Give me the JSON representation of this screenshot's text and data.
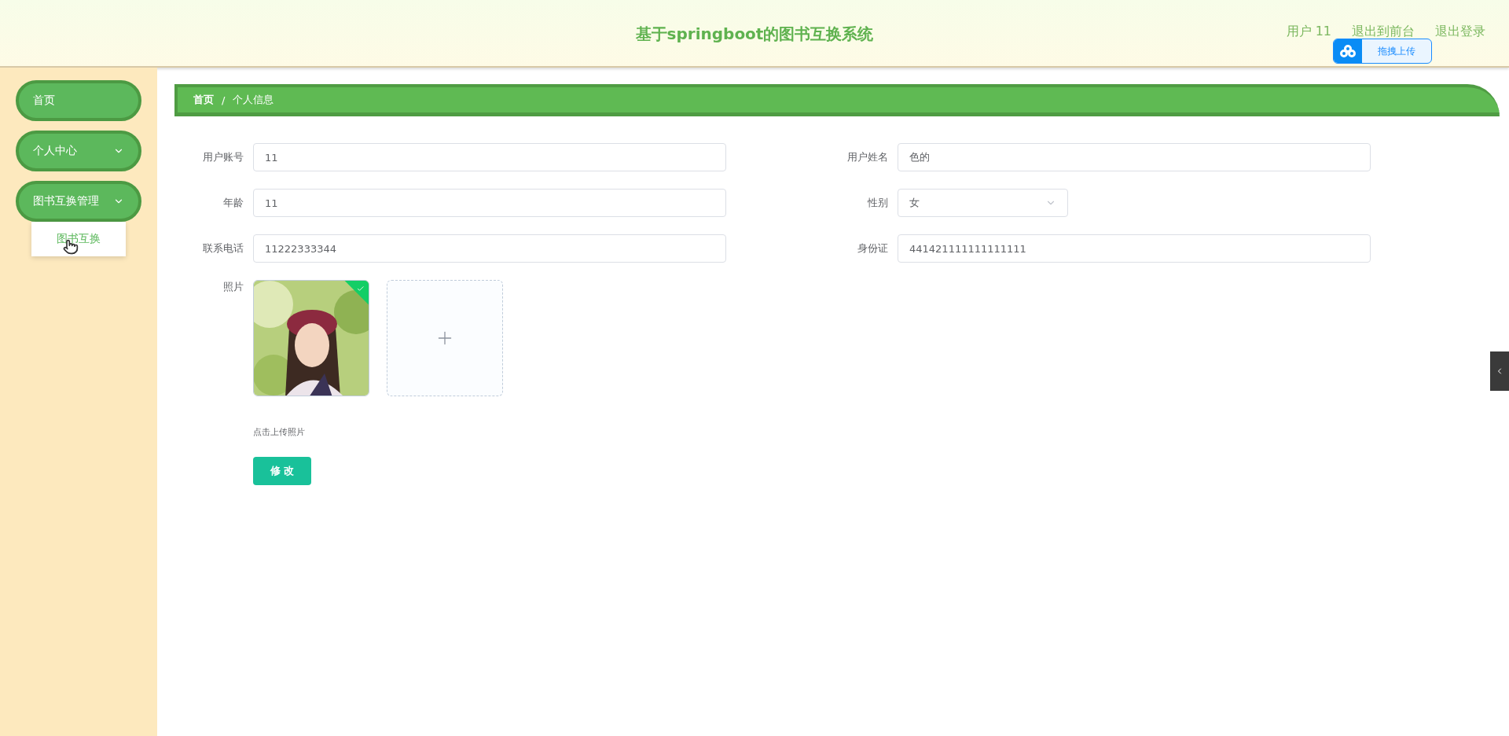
{
  "header": {
    "title": "基于springboot的图书互换系统",
    "links": [
      {
        "label": "用户 11"
      },
      {
        "label": "退出到前台"
      },
      {
        "label": "退出登录"
      }
    ]
  },
  "upload_popup": {
    "label": "拖拽上传"
  },
  "sidebar": {
    "items": [
      {
        "label": "首页",
        "kind": "link"
      },
      {
        "label": "个人中心",
        "kind": "group"
      },
      {
        "label": "图书互换管理",
        "kind": "group",
        "children": [
          {
            "label": "图书互换",
            "hovered": true
          }
        ]
      }
    ]
  },
  "breadcrumb": [
    "首页",
    "/",
    "个人信息"
  ],
  "form": {
    "left": [
      {
        "label": "用户账号",
        "value": "11",
        "kind": "text"
      },
      {
        "label": "年龄",
        "value": "11",
        "kind": "text"
      },
      {
        "label": "联系电话",
        "value": "11222333344",
        "kind": "text"
      }
    ],
    "right": [
      {
        "label": "用户姓名",
        "value": "色的",
        "kind": "text"
      },
      {
        "label": "性别",
        "value": "女",
        "kind": "select"
      },
      {
        "label": "身份证",
        "value": "441421111111111111",
        "kind": "text"
      }
    ],
    "photo": {
      "label": "照片",
      "uploaded": true,
      "hint": "点击上传照片"
    },
    "submit": "修 改"
  }
}
